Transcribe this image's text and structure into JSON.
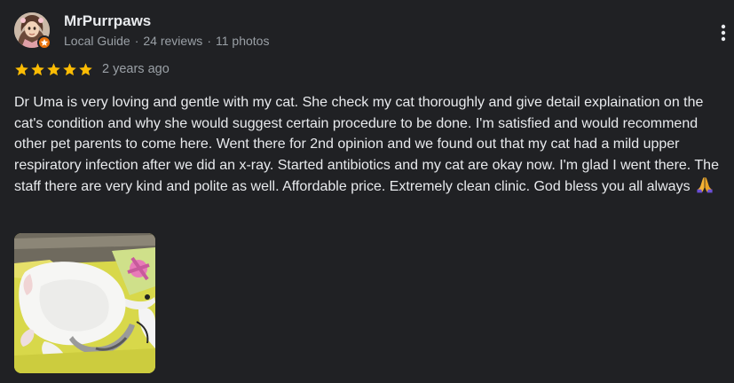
{
  "reviewer": {
    "name": "MrPurrpaws",
    "role": "Local Guide",
    "reviews": "24 reviews",
    "photos": "11 photos",
    "separator": "·",
    "avatar_icon": "user-avatar",
    "badge_icon": "local-guide-star-icon"
  },
  "rating": {
    "stars": 5,
    "max": 5,
    "date": "2 years ago",
    "star_color": "#fbbc04"
  },
  "review": {
    "text": "Dr Uma is very loving and gentle with my cat. She check my cat thoroughly and give detail explaination on the cat's condition and why she would suggest certain procedure to be done. I'm satisfied and would recommend other pet parents to come here. Went there for 2nd opinion and we found out that my cat had a mild upper respiratory infection after we did an x-ray. Started antibiotics and my cat are okay now. I'm glad I went there. The staff there are very kind and polite as well. Affordable price. Extremely clean clinic. God bless you all always",
    "emoji": "folded-hands-icon"
  },
  "photo": {
    "subject": "review-photo"
  },
  "menu": {
    "icon": "more-vert-icon"
  },
  "colors": {
    "background": "#202124",
    "primary_text": "#e8eaed",
    "secondary_text": "#9aa0a6",
    "badge": "#e8710a"
  }
}
